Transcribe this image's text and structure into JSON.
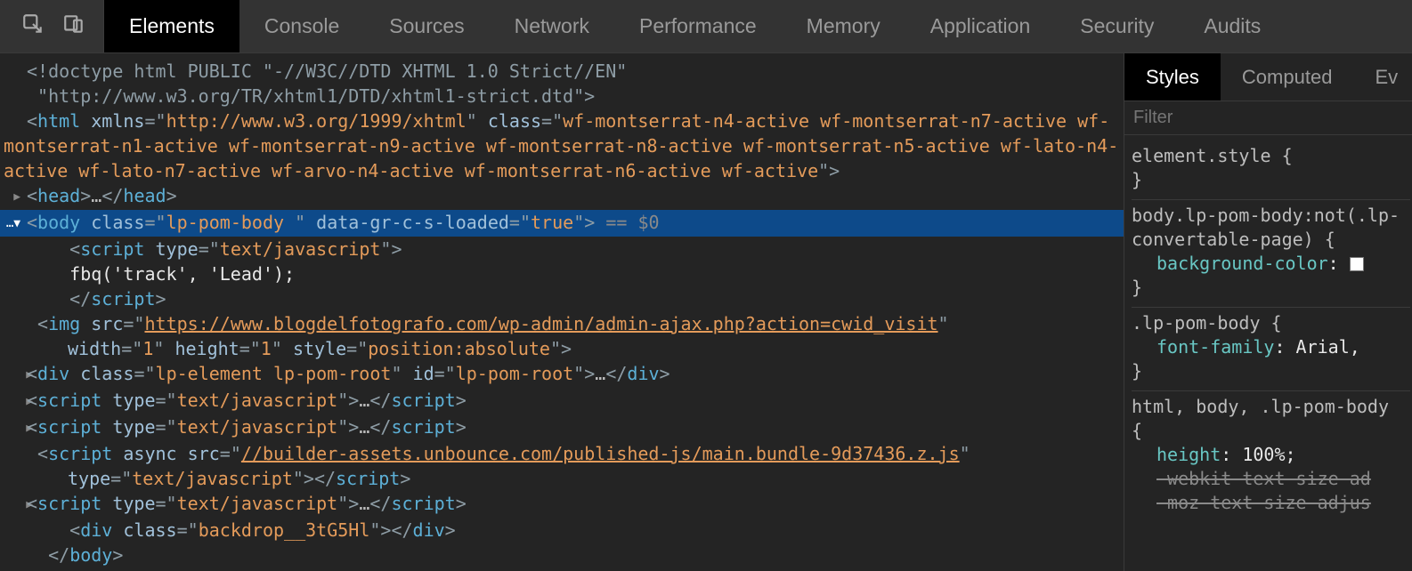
{
  "tabs": {
    "main": [
      "Elements",
      "Console",
      "Sources",
      "Network",
      "Performance",
      "Memory",
      "Application",
      "Security",
      "Audits"
    ],
    "activeIndex": 0
  },
  "side": {
    "tabs": [
      "Styles",
      "Computed",
      "Ev"
    ],
    "activeIndex": 0,
    "filter_placeholder": "Filter"
  },
  "dom": {
    "doctype_a": "<!doctype html PUBLIC \"-//W3C//DTD XHTML 1.0 Strict//EN\"",
    "doctype_b": " \"http://www.w3.org/TR/xhtml1/DTD/xhtml1-strict.dtd\">",
    "html_open_1": "<",
    "html_tag": "html",
    "html_attr1_name": "xmlns",
    "html_attr1_val": "http://www.w3.org/1999/xhtml",
    "html_attr2_name": "class",
    "html_classes": "wf-montserrat-n4-active wf-montserrat-n7-active wf-montserrat-n1-active wf-montserrat-n9-active wf-montserrat-n8-active wf-montserrat-n5-active wf-lato-n4-active wf-lato-n7-active wf-arvo-n4-active wf-montserrat-n6-active wf-active",
    "head_tag": "head",
    "body_tag": "body",
    "body_class_attr": "class",
    "body_class_val": "lp-pom-body ",
    "body_data_attr": "data-gr-c-s-loaded",
    "body_data_val": "true",
    "eq0": " == $0",
    "script_type_attr": "type",
    "script_type_val": "text/javascript",
    "fbq": "fbq('track', 'Lead');",
    "img_src_attr": "src",
    "img_src_val": "https://www.blogdelfotografo.com/wp-admin/admin-ajax.php?action=cwid_visit",
    "img_w_attr": "width",
    "img_w_val": "1",
    "img_h_attr": "height",
    "img_h_val": "1",
    "img_style_attr": "style",
    "img_style_val": "position:absolute",
    "div_class_attr": "class",
    "div_class_val": "lp-element lp-pom-root",
    "div_id_attr": "id",
    "div_id_val": "lp-pom-root",
    "async_attr": "async",
    "async_src": "//builder-assets.unbounce.com/published-js/main.bundle-9d37436.z.js",
    "backdrop_class": "backdrop__3tG5Hl",
    "ellipsis": "…"
  },
  "styles": {
    "r0_sel": "element.style",
    "r1_sel": "body.lp-pom-body:not(.lp-convertable-page)",
    "r1_prop": "background-color",
    "r2_sel": ".lp-pom-body",
    "r2_prop": "font-family",
    "r2_val": "Arial,",
    "r3_sel": "html, body, .lp-pom-body",
    "r3_p1": "height",
    "r3_v1": "100%",
    "r3_p2": "-webkit-text-size-ad",
    "r3_p3": "-moz-text-size-adjus"
  }
}
